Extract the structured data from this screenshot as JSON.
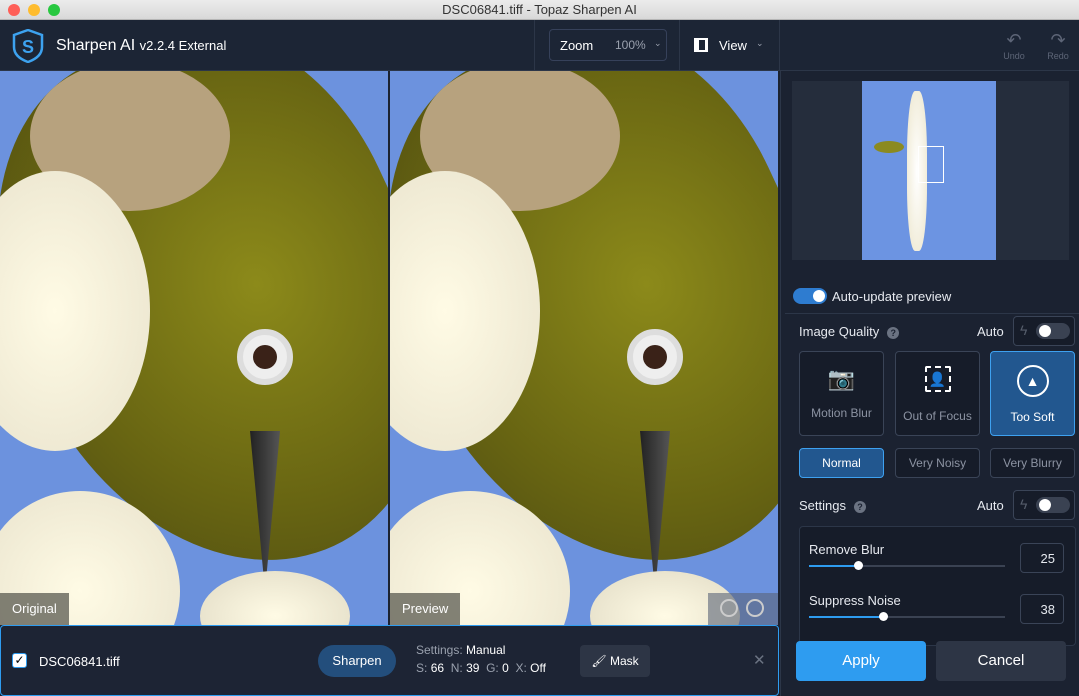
{
  "window": {
    "title": "DSC06841.tiff - Topaz Sharpen AI"
  },
  "header": {
    "app_name": "Sharpen AI",
    "version": "v2.2.4 External",
    "zoom_label": "Zoom",
    "zoom_value": "100%",
    "view_label": "View",
    "undo": "Undo",
    "redo": "Redo"
  },
  "viewer": {
    "original_label": "Original",
    "preview_label": "Preview"
  },
  "bottom": {
    "filename": "DSC06841.tiff",
    "checked": true,
    "sharpen": "Sharpen",
    "settings_label": "Settings:",
    "settings_value": "Manual",
    "s_label": "S:",
    "s": "66",
    "n_label": "N:",
    "n": "39",
    "g_label": "G:",
    "g": "0",
    "x_label": "X:",
    "x": "Off",
    "mask": "Mask",
    "close": "✕"
  },
  "panel": {
    "auto_update": "Auto-update preview",
    "auto_update_on": true,
    "image_quality": "Image Quality",
    "auto": "Auto",
    "modes": [
      {
        "label": "Motion Blur",
        "icon": "camera-shake-icon"
      },
      {
        "label": "Out of Focus",
        "icon": "focus-person-icon"
      },
      {
        "label": "Too Soft",
        "icon": "pyramid-icon",
        "selected": true
      }
    ],
    "levels": [
      {
        "label": "Normal",
        "selected": true
      },
      {
        "label": "Very Noisy"
      },
      {
        "label": "Very Blurry"
      }
    ],
    "settings": "Settings",
    "sliders": [
      {
        "label": "Remove Blur",
        "value": 25,
        "fraction": 0.25
      },
      {
        "label": "Suppress Noise",
        "value": 38,
        "fraction": 0.38
      }
    ],
    "apply": "Apply",
    "cancel": "Cancel"
  },
  "colors": {
    "accent": "#2e9cf0",
    "selected": "#22578f",
    "bg": "#1b2231"
  }
}
